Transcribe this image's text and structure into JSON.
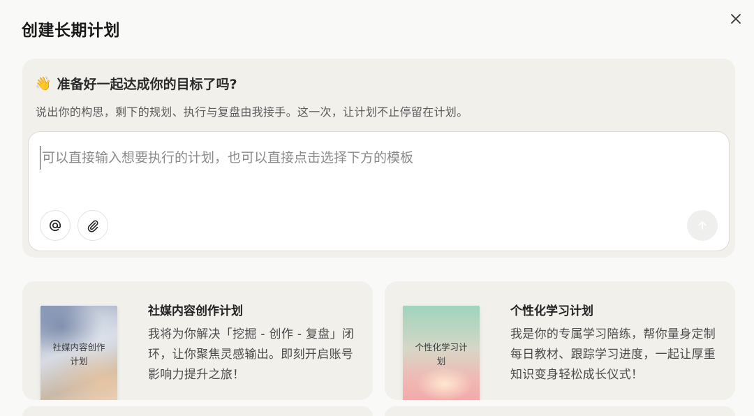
{
  "dialog": {
    "title": "创建长期计划"
  },
  "hero": {
    "emoji": "👋",
    "heading": "准备好一起达成你的目标了吗?",
    "subtitle": "说出你的构思，剩下的规划、执行与复盘由我接手。这一次，让计划不止停留在计划。"
  },
  "composer": {
    "value": "",
    "placeholder": "可以直接输入想要执行的计划，也可以直接点击选择下方的模板"
  },
  "templates": [
    {
      "cover_text": "社媒内容创作计划",
      "title": "社媒内容创作计划",
      "description": "我将为你解决「挖掘 - 创作 - 复盘」闭环，让你聚焦灵感输出。即刻开启账号影响力提升之旅！"
    },
    {
      "cover_text": "个性化学习计划",
      "title": "个性化学习计划",
      "description": "我是你的专属学习陪练，帮你量身定制每日教材、跟踪学习进度，一起让厚重知识变身轻松成长仪式！"
    }
  ],
  "icons": {
    "close": "close-icon",
    "mention": "at-sign-icon",
    "attach": "paperclip-icon",
    "send": "arrow-up-icon"
  }
}
